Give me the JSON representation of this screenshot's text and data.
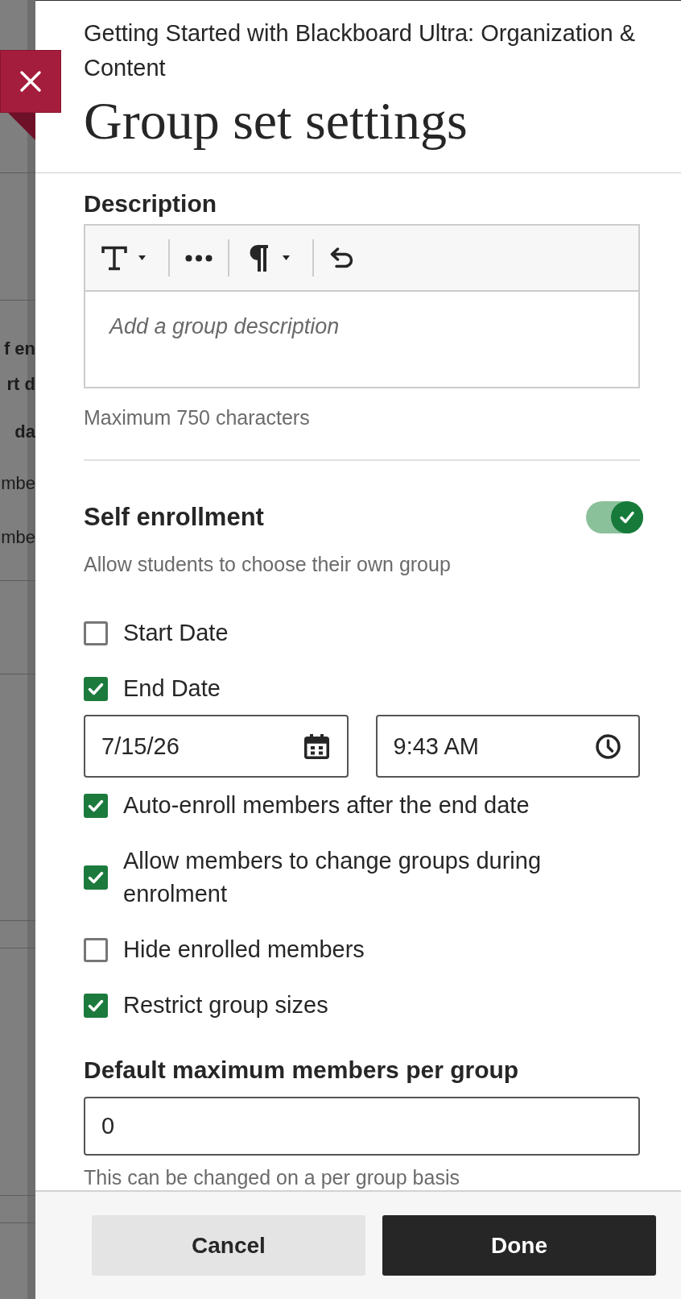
{
  "background_page": {
    "fragments": [
      {
        "text": "f en",
        "bold": true
      },
      {
        "text": "rt d",
        "bold": true
      },
      {
        "text": "da",
        "bold": true
      },
      {
        "text": "mbe",
        "bold": false
      },
      {
        "text": "mbe",
        "bold": false
      }
    ]
  },
  "header": {
    "course": "Getting Started with Blackboard Ultra: Organization & Content",
    "title": "Group set settings"
  },
  "description": {
    "label": "Description",
    "placeholder": "Add a group description",
    "hint": "Maximum 750 characters"
  },
  "self_enrollment": {
    "label": "Self enrollment",
    "on": true,
    "hint": "Allow students to choose their own group",
    "options": [
      {
        "label": "Start Date",
        "checked": false
      },
      {
        "label": "End Date",
        "checked": true,
        "date": "7/15/26",
        "time": "9:43 AM"
      },
      {
        "label": "Auto-enroll members after the end date",
        "checked": true
      },
      {
        "label": "Allow members to change groups during enrolment",
        "checked": true
      },
      {
        "label": "Hide enrolled members",
        "checked": false
      },
      {
        "label": "Restrict group sizes",
        "checked": true
      }
    ]
  },
  "max_members": {
    "label": "Default maximum members per group",
    "value": "0",
    "hint": "This can be changed on a per group basis"
  },
  "footer": {
    "buttons": [
      {
        "label": "Cancel",
        "kind": "secondary"
      },
      {
        "label": "Done",
        "kind": "primary"
      }
    ]
  }
}
